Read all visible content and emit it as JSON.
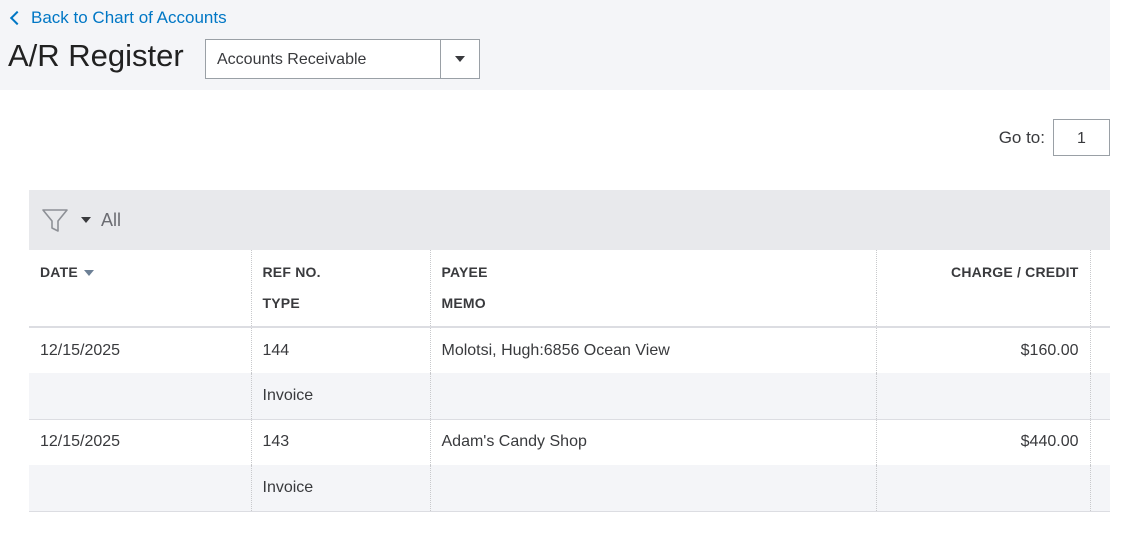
{
  "back_link": "Back to Chart of Accounts",
  "title": "A/R Register",
  "account_select": {
    "value": "Accounts Receivable"
  },
  "goto": {
    "label": "Go to:",
    "value": "1"
  },
  "filter": {
    "label": "All"
  },
  "columns": {
    "date": "DATE",
    "ref_no": "REF NO.",
    "type": "TYPE",
    "payee": "PAYEE",
    "memo": "MEMO",
    "charge_credit": "CHARGE / CREDIT"
  },
  "rows": [
    {
      "date": "12/15/2025",
      "ref_no": "144",
      "type": "Invoice",
      "payee": "Molotsi, Hugh:6856 Ocean View",
      "memo": "",
      "charge": "$160.00"
    },
    {
      "date": "12/15/2025",
      "ref_no": "143",
      "type": "Invoice",
      "payee": "Adam's Candy Shop",
      "memo": "",
      "charge": "$440.00"
    }
  ],
  "colors": {
    "link": "#0077c5",
    "header_bg": "#f4f5f8",
    "filter_bg": "#e8e9ec",
    "text": "#393a3d"
  }
}
